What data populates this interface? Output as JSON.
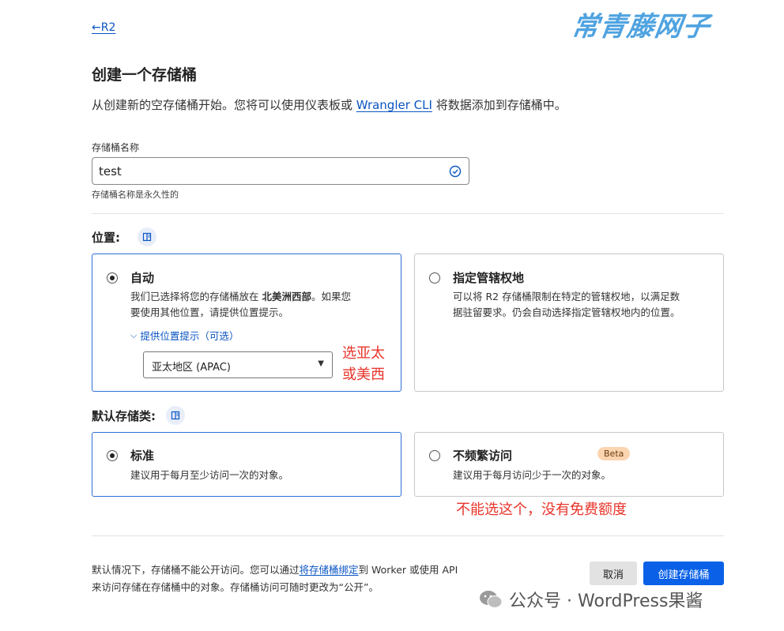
{
  "nav": {
    "back_label": "←R2"
  },
  "page": {
    "title": "创建一个存储桶",
    "subtitle_pre": "从创建新的空存储桶开始。您将可以使用仪表板或 ",
    "subtitle_link": "Wrangler CLI",
    "subtitle_post": " 将数据添加到存储桶中。"
  },
  "bucket_name": {
    "label": "存储桶名称",
    "value": "test",
    "hint": "存储桶名称是永久性的",
    "status_icon": "check-circle-icon"
  },
  "location": {
    "label": "位置:",
    "options": [
      {
        "title": "自动",
        "selected": true,
        "desc_line1_pre": "我们已选择将您的存储桶放在 ",
        "desc_line1_bold": "北美洲西部",
        "desc_line1_post": "。如果您",
        "desc_line2": "要使用其他位置，请提供位置提示。",
        "hint_toggle": "提供位置提示（可选）",
        "hint_value": "亚太地区 (APAC)"
      },
      {
        "title": "指定管辖权地",
        "selected": false,
        "desc_line1": "可以将 R2 存储桶限制在特定的管辖权地，以满足数",
        "desc_line2": "据驻留要求。仍会自动选择指定管辖权地内的位置。"
      }
    ],
    "annotation_line1": "选亚太",
    "annotation_line2": "或美西"
  },
  "storage_class": {
    "label": "默认存储类:",
    "options": [
      {
        "title": "标准",
        "selected": true,
        "desc": "建议用于每月至少访问一次的对象。"
      },
      {
        "title": "不频繁访问",
        "selected": false,
        "badge": "Beta",
        "desc": "建议用于每月访问少于一次的对象。"
      }
    ],
    "annotation": "不能选这个，没有免费额度"
  },
  "footer": {
    "text_pre": "默认情况下，存储桶不能公开访问。您可以通过",
    "text_link": "将存储桶绑定",
    "text_post": "到 Worker 或使用 API",
    "text_line2": "来访问存储在存储桶中的对象。存储桶访问可随时更改为“公开”。",
    "cancel_label": "取消",
    "create_label": "创建存储桶"
  },
  "watermarks": {
    "top": "常青藤网子",
    "bottom": "公众号 · WordPress果酱"
  },
  "colors": {
    "primary": "#0a55c2",
    "create_button": "#0a61e8",
    "annotation_red": "#e8342a",
    "selected_border": "#2f6fd6"
  }
}
